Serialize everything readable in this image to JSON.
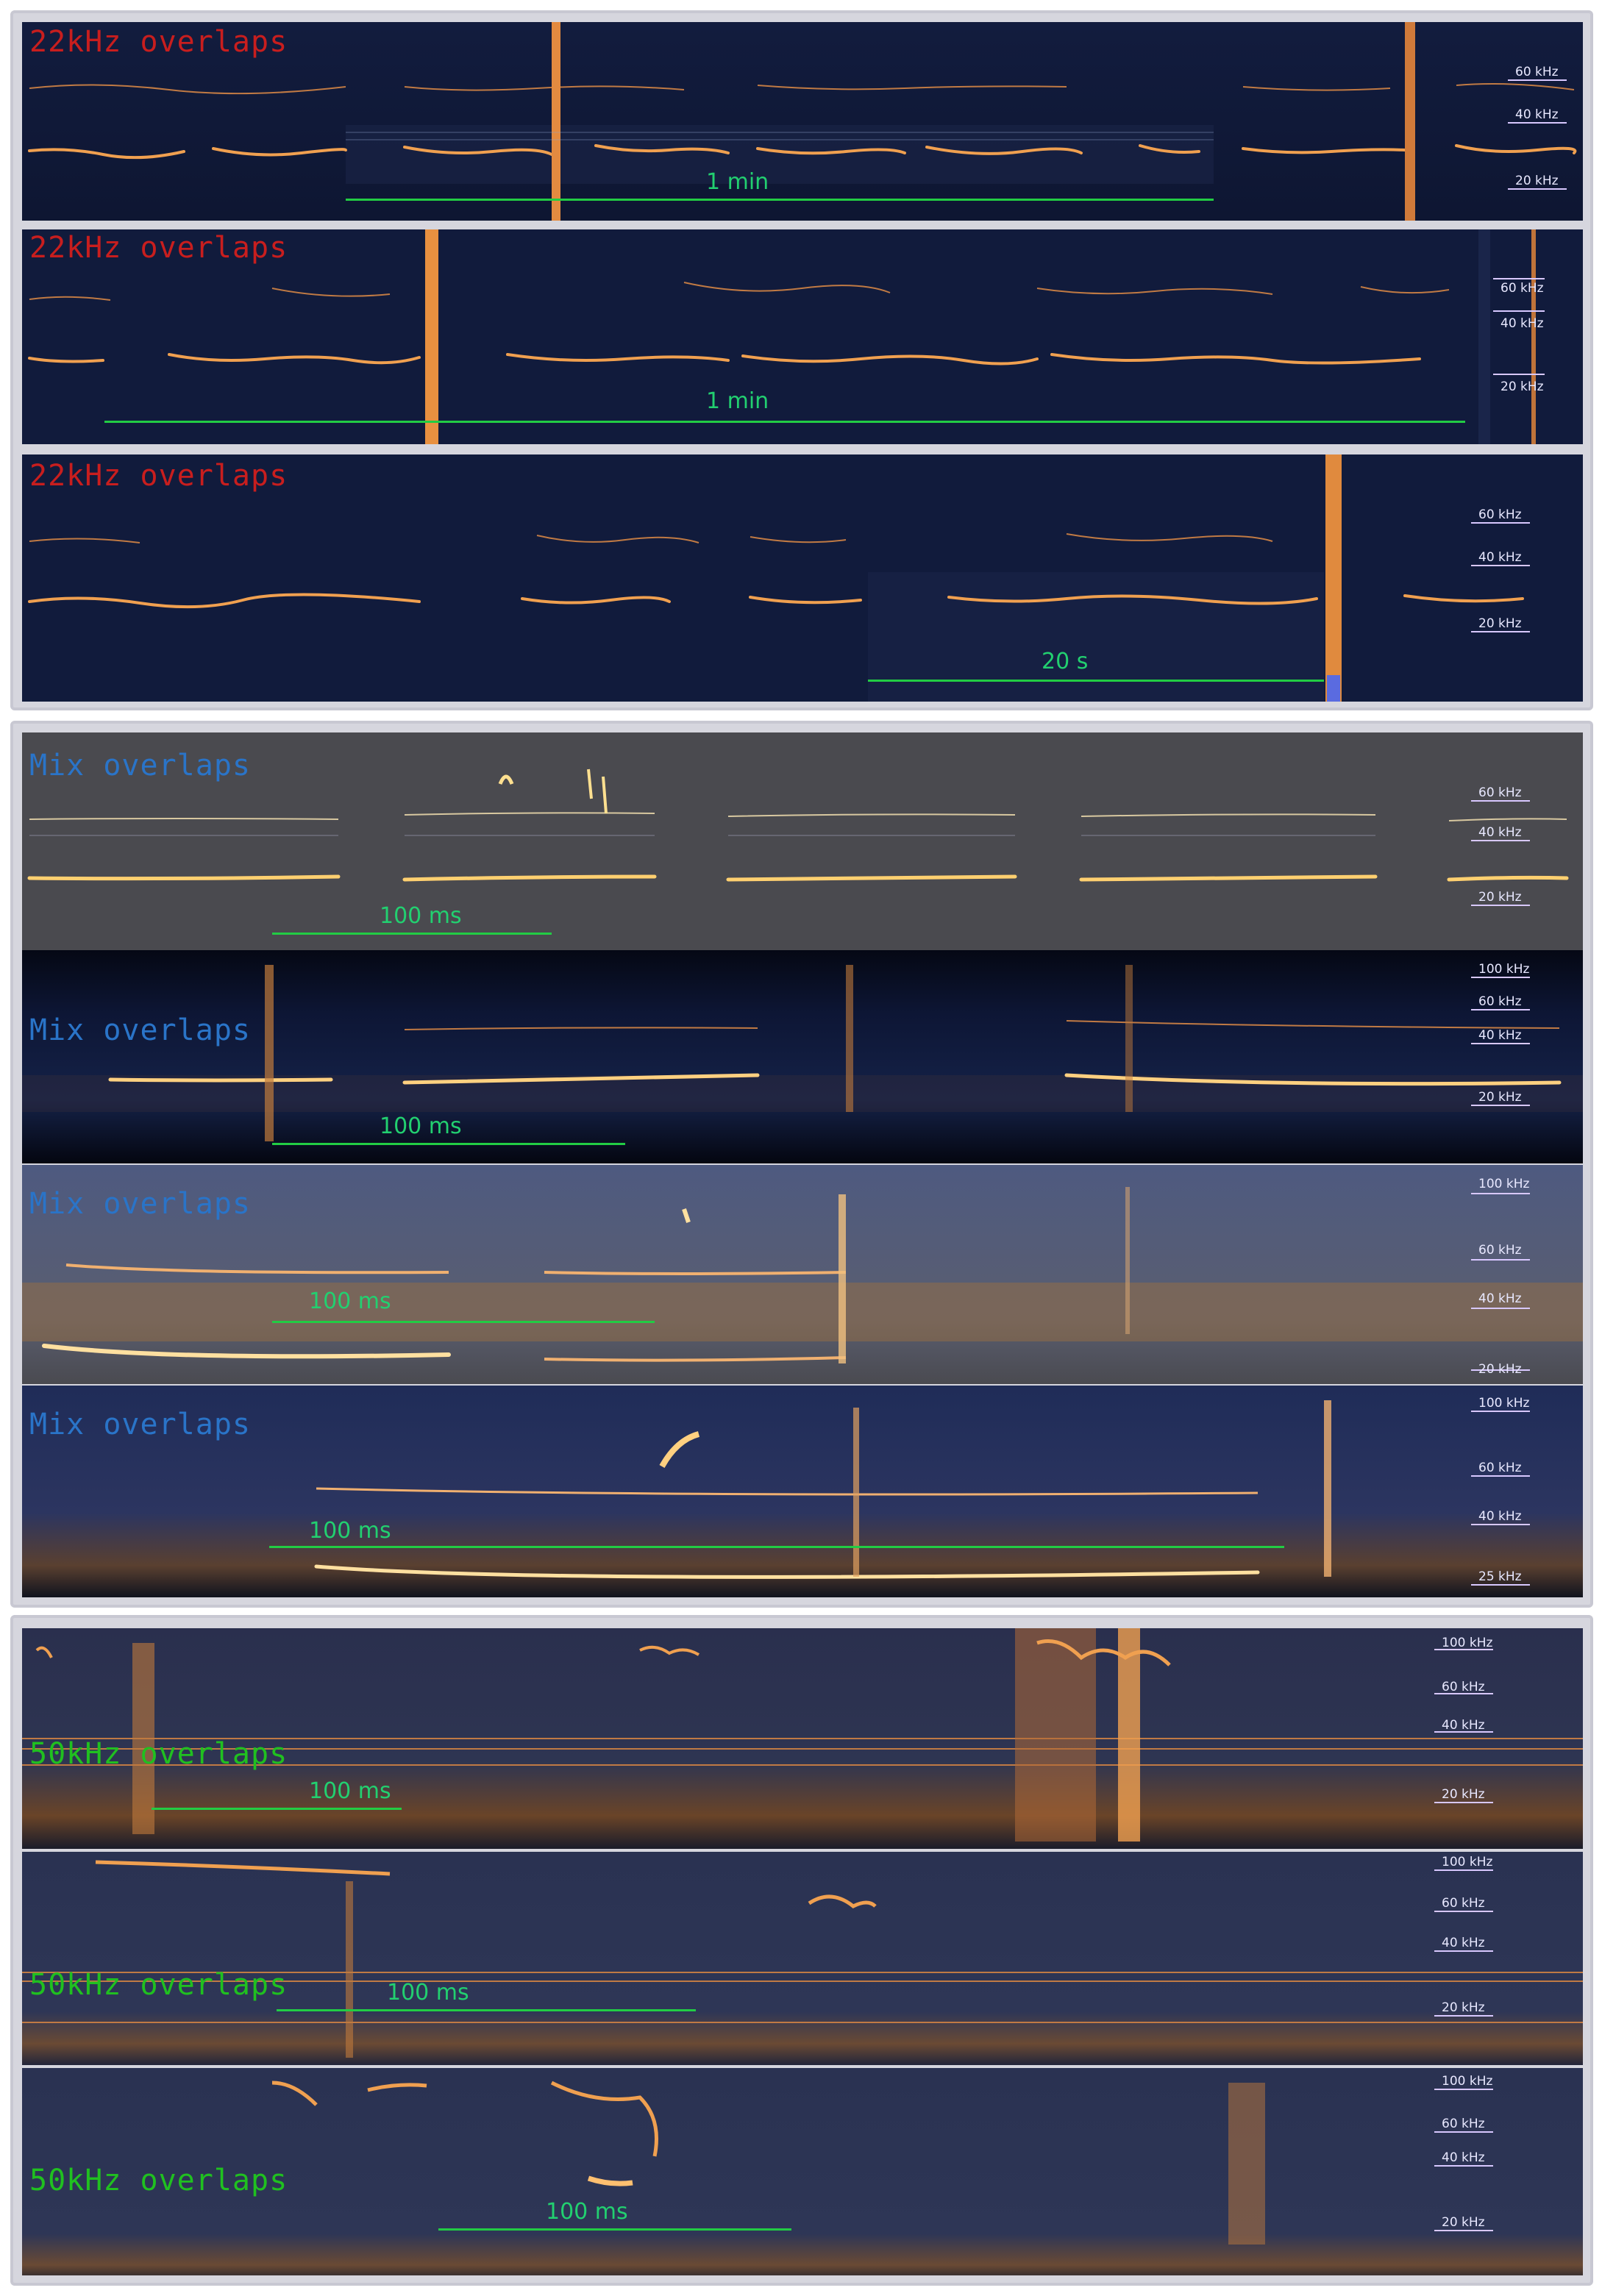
{
  "colors": {
    "label_22khz": "#c81e1e",
    "label_mix": "#2a74c8",
    "label_50khz": "#20c020",
    "scale_bar": "#22cc44",
    "background_dark": "#101a3a",
    "signal": "#f0a050",
    "frame": "#d6d6de"
  },
  "groups": [
    {
      "panels": [
        {
          "label": "22kHz overlaps",
          "scale_label": "1  min",
          "ticks": [
            "60 kHz",
            "40 kHz",
            "20 kHz"
          ]
        },
        {
          "label": "22kHz overlaps",
          "scale_label": "1 min",
          "ticks": [
            "60 kHz",
            "40 kHz",
            "20 kHz"
          ]
        },
        {
          "label": "22kHz overlaps",
          "scale_label": "20 s",
          "ticks": [
            "60 kHz",
            "40 kHz",
            "20 kHz"
          ]
        }
      ]
    },
    {
      "panels": [
        {
          "label": "Mix overlaps",
          "scale_label": "100 ms",
          "ticks": [
            "60 kHz",
            "40 kHz",
            "20 kHz"
          ]
        },
        {
          "label": "Mix overlaps",
          "scale_label": "100 ms",
          "ticks": [
            "100 kHz",
            "60 kHz",
            "40 kHz",
            "20 kHz"
          ]
        },
        {
          "label": "Mix overlaps",
          "scale_label": "100 ms",
          "ticks": [
            "100 kHz",
            "60 kHz",
            "40 kHz",
            "20 kHz"
          ]
        },
        {
          "label": "Mix overlaps",
          "scale_label": "100 ms",
          "ticks": [
            "100 kHz",
            "60 kHz",
            "40 kHz",
            "25 kHz"
          ]
        }
      ]
    },
    {
      "panels": [
        {
          "label": "50kHz overlaps",
          "scale_label": "100 ms",
          "ticks": [
            "100 kHz",
            "60 kHz",
            "40 kHz",
            "20 kHz"
          ]
        },
        {
          "label": "50kHz overlaps",
          "scale_label": "100 ms",
          "ticks": [
            "100 kHz",
            "60 kHz",
            "40 kHz",
            "20 kHz"
          ]
        },
        {
          "label": "50kHz overlaps",
          "scale_label": "100 ms",
          "ticks": [
            "100 kHz",
            "60 kHz",
            "40 kHz",
            "20 kHz"
          ]
        }
      ]
    }
  ]
}
